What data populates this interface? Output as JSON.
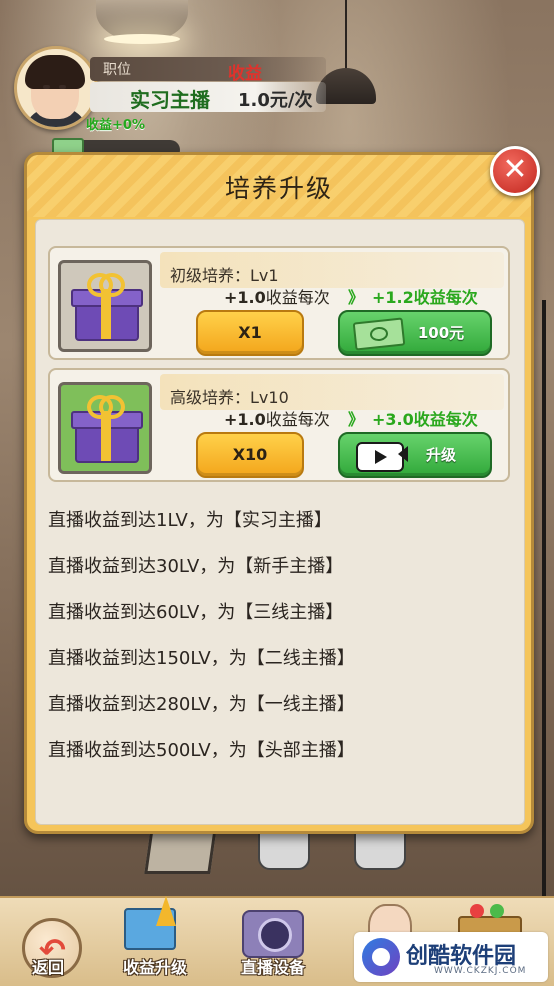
{
  "header": {
    "job_label": "职位",
    "income_label": "收益",
    "title": "实习主播",
    "rate": "1.0元/次",
    "bonus": "收益+0%"
  },
  "modal": {
    "title": "培养升级",
    "close_symbol": "✕",
    "cards": [
      {
        "name": "初级培养：Lv1",
        "gain_prefix": "+1.0",
        "gain_unit": "收益每次",
        "arrow": "》",
        "next_gain": "+1.2收益每次",
        "multiplier": "X1",
        "action_label": "100元",
        "action_icon": "cash-icon"
      },
      {
        "name": "高级培养：Lv10",
        "gain_prefix": "+1.0",
        "gain_unit": "收益每次",
        "arrow": "》",
        "next_gain": "+3.0收益每次",
        "multiplier": "X10",
        "action_label": "升级",
        "action_icon": "video-icon"
      }
    ],
    "levels": [
      "直播收益到达1LV，为【实习主播】",
      "直播收益到达30LV，为【新手主播】",
      "直播收益到达60LV，为【三线主播】",
      "直播收益到达150LV，为【二线主播】",
      "直播收益到达280LV，为【一线主播】",
      "直播收益到达500LV，为【头部主播】"
    ]
  },
  "bottom_nav": {
    "back": "返回",
    "income_upgrade": "收益升级",
    "live_equipment": "直播设备"
  },
  "watermark": {
    "text": "创酷软件园",
    "sub": "WWW.CKZKJ.COM"
  },
  "colors": {
    "accent_gold": "#f5c55a",
    "green_button": "#31a83a",
    "yellow_button": "#f3a51b",
    "gain_green": "#2aa81e",
    "income_red": "#e0322c"
  }
}
